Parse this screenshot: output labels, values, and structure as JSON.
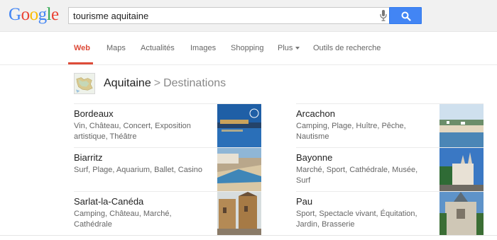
{
  "logo": {
    "letters": [
      "G",
      "o",
      "o",
      "g",
      "l",
      "e"
    ],
    "colors": [
      "#4285f4",
      "#ea4335",
      "#fbbc05",
      "#4285f4",
      "#34a853",
      "#ea4335"
    ]
  },
  "search": {
    "query": "tourisme aquitaine"
  },
  "tabs": [
    {
      "label": "Web",
      "active": true
    },
    {
      "label": "Maps",
      "active": false
    },
    {
      "label": "Actualités",
      "active": false
    },
    {
      "label": "Images",
      "active": false
    },
    {
      "label": "Shopping",
      "active": false
    },
    {
      "label": "Plus",
      "active": false
    },
    {
      "label": "Outils de recherche",
      "active": false
    }
  ],
  "breadcrumb": {
    "region": "Aquitaine",
    "separator": ">",
    "section": "Destinations"
  },
  "destinations": [
    {
      "name": "Bordeaux",
      "description": "Vin, Château, Concert, Exposition artistique, Théâtre"
    },
    {
      "name": "Arcachon",
      "description": "Camping, Plage, Huître, Pêche, Nautisme"
    },
    {
      "name": "Biarritz",
      "description": "Surf, Plage, Aquarium, Ballet, Casino"
    },
    {
      "name": "Bayonne",
      "description": "Marché, Sport, Cathédrale, Musée, Surf"
    },
    {
      "name": "Sarlat-la-Canéda",
      "description": "Camping, Château, Marché, Cathédrale"
    },
    {
      "name": "Pau",
      "description": "Sport, Spectacle vivant, Équitation, Jardin, Brasserie"
    }
  ],
  "colors": {
    "accent": "#dd4b39",
    "search_button": "#4285f4",
    "header_bg": "#f1f1f1"
  }
}
